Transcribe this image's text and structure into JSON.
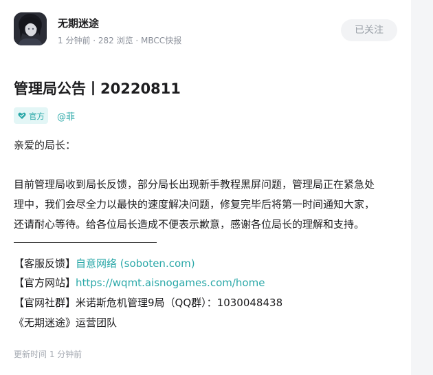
{
  "author": {
    "name": "无期迷途",
    "meta": "1 分钟前 · 282 浏览 · MBCC快报"
  },
  "follow_button": {
    "label": "已关注"
  },
  "post": {
    "title": "管理局公告丨20220811",
    "official_badge": "官方",
    "editor": "@菲",
    "greeting": "亲爱的局长：",
    "body_lines": [
      "目前管理局收到局长反馈，部分局长出现新手教程黑屏问题，管理局正在紧急处",
      "理中，我们会尽全力以最快的速度解决问题，修复完毕后将第一时间通知大家，",
      "还请耐心等待。给各位局长造成不便表示歉意，感谢各位局长的理解和支持。"
    ],
    "info": [
      {
        "label": "【客服反馈】",
        "value": "自意网络 (soboten.com)",
        "is_link": true
      },
      {
        "label": "【官方网站】",
        "value": "https://wqmt.aisnogames.com/home",
        "is_link": true
      },
      {
        "label": "【官网社群】",
        "value": "米诺斯危机管理9局（QQ群）：1030048438",
        "is_link": false
      }
    ],
    "signature": "《无期迷途》运营团队",
    "updated": "更新时间 1 分钟前"
  },
  "colors": {
    "accent": "#2aa8a8",
    "badge_bg": "#e3f6f6",
    "muted": "#8a8f99",
    "page_bg": "#f4f5f7"
  }
}
